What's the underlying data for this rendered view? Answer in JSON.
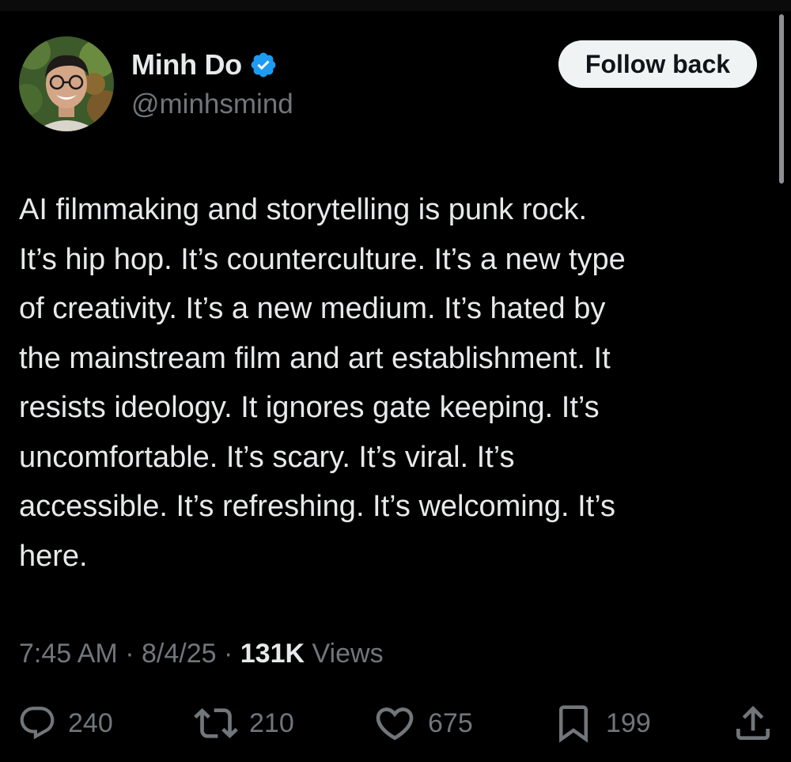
{
  "user": {
    "display_name": "Minh Do",
    "handle": "@minhsmind",
    "verified": true
  },
  "follow_button": {
    "label": "Follow back"
  },
  "tweet": {
    "lines": [
      "AI filmmaking and storytelling is punk rock.",
      "It’s hip hop. It’s counterculture. It’s a new type",
      "of creativity. It’s a new medium. It’s hated by",
      "the mainstream film and art establishment. It",
      "resists ideology. It ignores gate keeping. It’s",
      "uncomfortable. It’s scary. It’s viral. It’s",
      "accessible. It’s refreshing. It’s welcoming. It’s",
      "here."
    ]
  },
  "meta": {
    "time": "7:45 AM",
    "separator": "·",
    "date": "8/4/25",
    "views_count": "131K",
    "views_label": "Views"
  },
  "actions": {
    "replies": "240",
    "reposts": "210",
    "likes": "675",
    "bookmarks": "199"
  },
  "icons": {
    "verified": "verified-badge-icon",
    "reply": "reply-icon",
    "repost": "repost-icon",
    "like": "heart-icon",
    "bookmark": "bookmark-icon",
    "share": "share-icon"
  },
  "colors": {
    "background": "#000000",
    "text": "#e7e9ea",
    "secondary": "#71767b",
    "verified": "#1d9bf0",
    "button_bg": "#eff3f4"
  }
}
